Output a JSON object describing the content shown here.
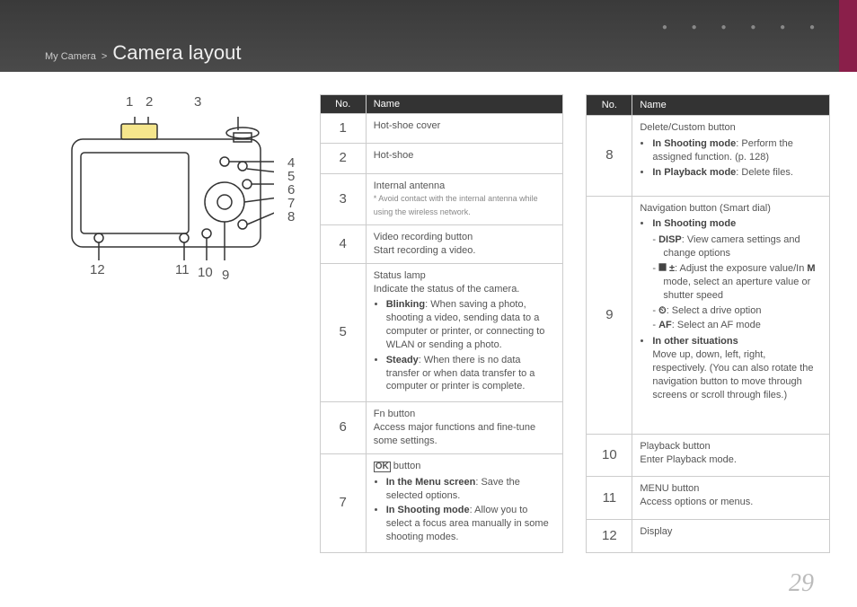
{
  "breadcrumb": {
    "section": "My Camera",
    "sep": ">",
    "title": "Camera layout"
  },
  "pageNumber": "29",
  "diagram": {
    "labels": [
      "1",
      "2",
      "3",
      "4",
      "5",
      "6",
      "7",
      "8",
      "9",
      "10",
      "11",
      "12"
    ]
  },
  "headers": {
    "no": "No.",
    "name": "Name"
  },
  "left": [
    {
      "no": "1",
      "html": "Hot-shoe cover"
    },
    {
      "no": "2",
      "html": "Hot-shoe"
    },
    {
      "no": "3",
      "html": "Internal antenna<br><span class=\"foot\">* Avoid contact with the internal antenna while using the wireless network.</span>"
    },
    {
      "no": "4",
      "html": "Video recording button<br>Start recording a video."
    },
    {
      "no": "5",
      "html": "Status lamp<br>Indicate the status of the camera.<ul><li><b>Blinking</b>: When saving a photo, shooting a video, sending data to a computer or printer, or connecting to WLAN or sending a photo.</li><li><b>Steady</b>: When there is no data transfer or when data transfer to a computer or printer is complete.</li></ul>"
    },
    {
      "no": "6",
      "html": "Fn button<br>Access major functions and fine-tune some settings."
    },
    {
      "no": "7",
      "html": "<span class=\"glyph\">OK</span> button<ul><li><b>In the Menu screen</b>: Save the selected options.</li><li><b>In Shooting mode</b>: Allow you to select a focus area manually in some shooting modes.</li></ul>"
    }
  ],
  "right": [
    {
      "no": "8",
      "html": "Delete/Custom button<ul><li><b>In Shooting mode</b>: Perform the assigned function. (p. 128)</li><li><b>In Playback mode</b>: Delete files.</li></ul>"
    },
    {
      "no": "9",
      "html": "Navigation button (Smart dial)<ul><li><b>In Shooting mode</b><ul class=\"dash\"><li><b>DISP</b>: View camera settings and change options</li><li><b>⯀ ±</b>: Adjust the exposure value/In <b>M</b> mode, select an aperture value or shutter speed</li><li><b>⏲</b>: Select a drive option</li><li><b>AF</b>: Select an AF mode</li></ul></li><li><b>In other situations</b><br>Move up, down, left, right, respectively. (You can also rotate the navigation button to move through screens or scroll through files.)</li></ul>"
    },
    {
      "no": "10",
      "html": "Playback button<br>Enter Playback mode."
    },
    {
      "no": "11",
      "html": "MENU button<br>Access options or menus."
    },
    {
      "no": "12",
      "html": "Display"
    }
  ]
}
